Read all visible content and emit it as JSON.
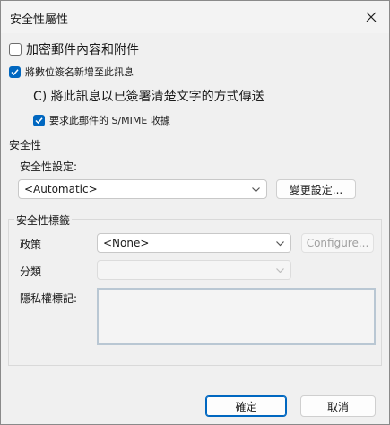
{
  "dialog": {
    "title": "安全性屬性"
  },
  "options": {
    "encrypt_label": "加密郵件內容和附件",
    "encrypt_checked": false,
    "add_signature_label": "將數位簽名新增至此訊息",
    "add_signature_checked": true,
    "send_clear_label": "C) 將此訊息以已簽署清楚文字的方式傳送",
    "request_receipt_label": "要求此郵件的 S/MIME 收據",
    "request_receipt_checked": true
  },
  "security": {
    "section_label": "安全性",
    "settings_label": "安全性設定:",
    "settings_value": "<Automatic>",
    "change_settings_button": "變更設定..."
  },
  "security_label": {
    "group_label": "安全性標籤",
    "policy_label": "政策",
    "policy_value": "<None>",
    "configure_button": "Configure...",
    "classification_label": "分類",
    "classification_value": "",
    "privacy_mark_label": "隱私權標記:",
    "privacy_mark_value": ""
  },
  "footer": {
    "ok_button": "確定",
    "cancel_button": "取消"
  },
  "colors": {
    "accent": "#0067c0"
  }
}
